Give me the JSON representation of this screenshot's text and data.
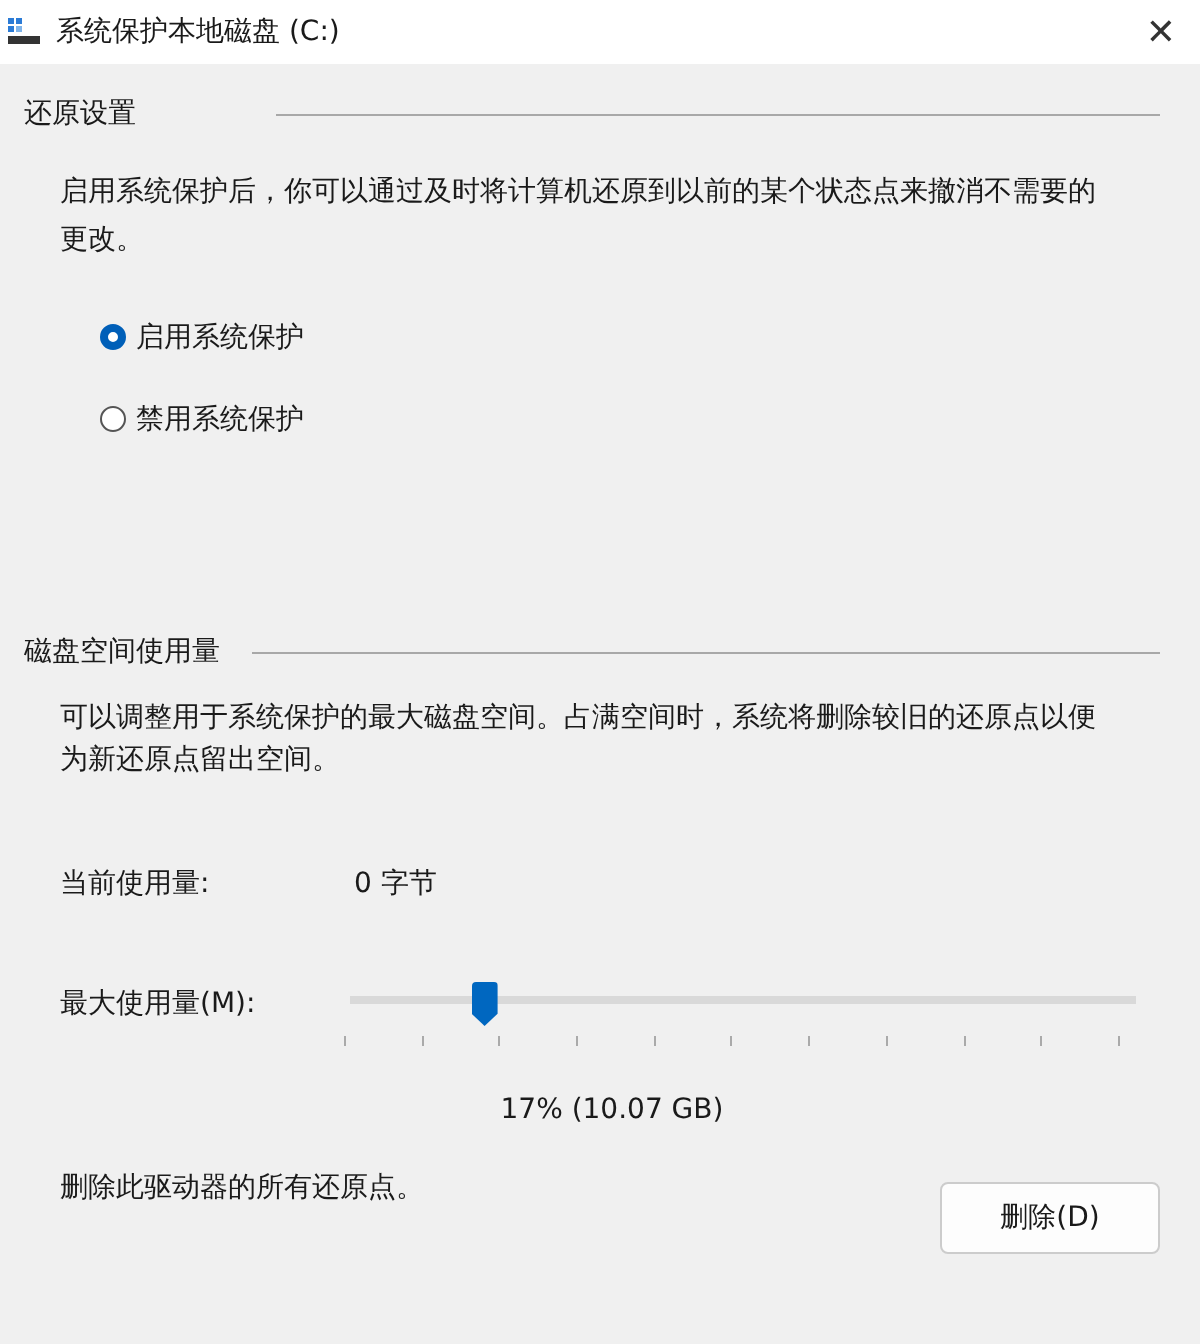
{
  "window": {
    "title": "系统保护本地磁盘 (C:)",
    "close": "✕"
  },
  "restore_settings": {
    "heading": "还原设置",
    "description": "启用系统保护后，你可以通过及时将计算机还原到以前的某个状态点来撤消不需要的更改。",
    "options": [
      {
        "label": "启用系统保护",
        "selected": true
      },
      {
        "label": "禁用系统保护",
        "selected": false
      }
    ]
  },
  "disk_usage": {
    "heading": "磁盘空间使用量",
    "description": "可以调整用于系统保护的最大磁盘空间。占满空间时，系统将删除较旧的还原点以便为新还原点留出空间。",
    "current_label": "当前使用量:",
    "current_value": "0 字节",
    "max_label": "最大使用量(M):",
    "level": 0.17,
    "reading": "17% (10.07 GB)",
    "delete_text": "删除此驱动器的所有还原点。",
    "delete_button": "删除(D)"
  }
}
